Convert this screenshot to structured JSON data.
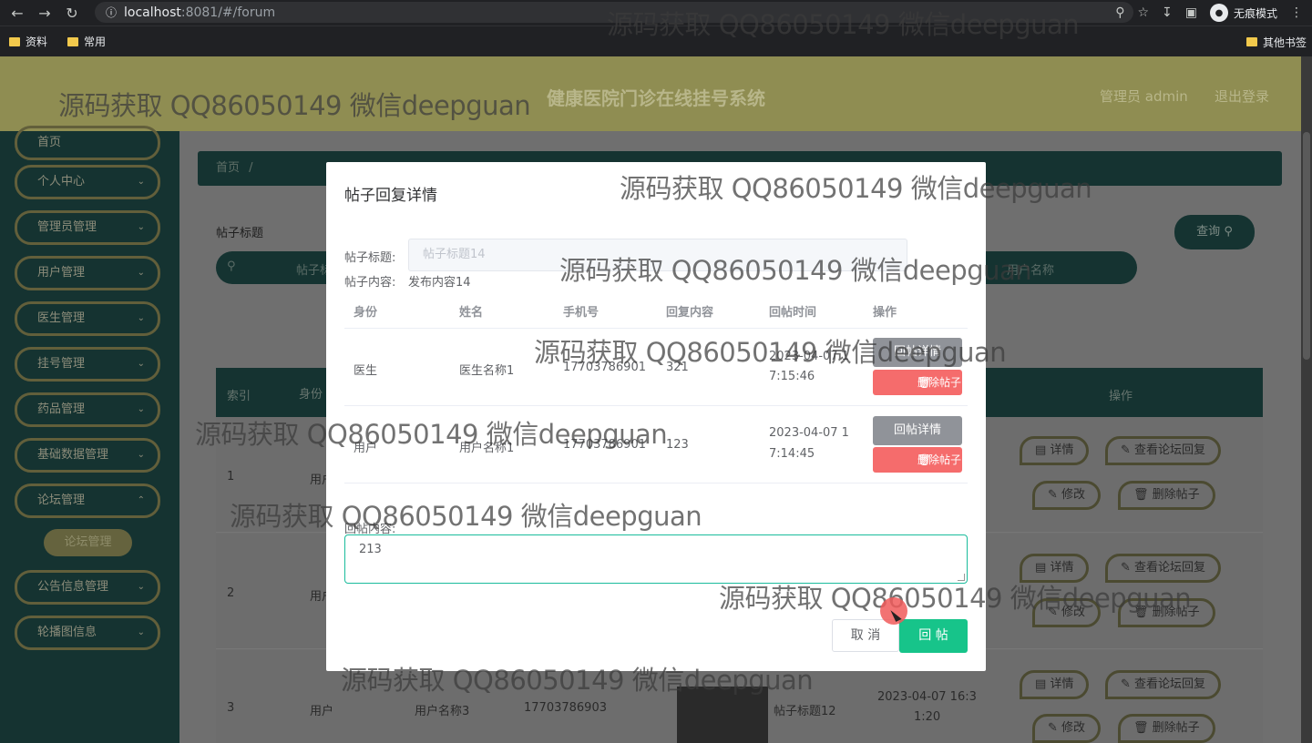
{
  "browser": {
    "url_host": "localhost",
    "url_path": ":8081/#/forum",
    "incognito_label": "无痕模式",
    "bookmarks": [
      "资料",
      "常用"
    ],
    "other_bookmarks": "其他书签"
  },
  "header": {
    "title": "健康医院门诊在线挂号系统",
    "user_label": "管理员 admin",
    "logout_label": "退出登录"
  },
  "sidebar": {
    "items": [
      "首页",
      "个人中心",
      "管理员管理",
      "用户管理",
      "医生管理",
      "挂号管理",
      "药品管理",
      "基础数据管理",
      "论坛管理",
      "公告信息管理",
      "轮播图信息"
    ],
    "active_sub": "论坛管理"
  },
  "main": {
    "breadcrumb_home": "首页",
    "breadcrumb_sep": "/",
    "search_label": "帖子标题",
    "search_placeholder": "帖子标",
    "search_user_placeholder": "用户名称",
    "query_button": "查询",
    "table_headers": [
      "索引",
      "身份",
      "操作"
    ],
    "rows": [
      {
        "index": "1",
        "identity": "用户"
      },
      {
        "index": "2",
        "identity": "用户"
      },
      {
        "index": "3",
        "identity": "用户",
        "name": "用户名称3",
        "phone": "17703786903",
        "title": "帖子标题12",
        "time_line1": "2023-04-07 16:3",
        "time_line2": "1:20"
      }
    ],
    "action_buttons": {
      "detail": "详情",
      "view_replies": "查看论坛回复",
      "edit": "修改",
      "delete": "删除帖子"
    }
  },
  "modal": {
    "title": "帖子回复详情",
    "post_title_label": "帖子标题:",
    "post_title_value": "帖子标题14",
    "post_content_label": "帖子内容:",
    "post_content_value": "发布内容14",
    "columns": [
      "身份",
      "姓名",
      "手机号",
      "回复内容",
      "回帖时间",
      "操作"
    ],
    "replies": [
      {
        "identity": "医生",
        "name": "医生名称1",
        "phone": "17703786901",
        "content": "321",
        "time_line1": "2023-04-07 1",
        "time_line2": "7:15:46"
      },
      {
        "identity": "用户",
        "name": "用户名称1",
        "phone": "17703786901",
        "content": "123",
        "time_line1": "2023-04-07 1",
        "time_line2": "7:14:45"
      }
    ],
    "reply_detail_button": "回帖详情",
    "delete_button": "删除帖子",
    "reply_label": "回帖内容:",
    "reply_value": "213",
    "cancel_button": "取 消",
    "submit_button": "回 帖"
  },
  "watermark": "源码获取 QQ86050149 微信deepguan"
}
